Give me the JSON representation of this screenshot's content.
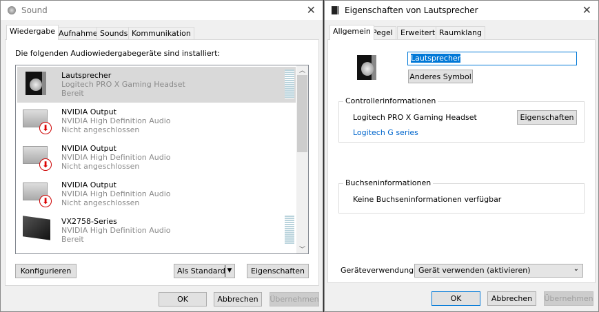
{
  "sound": {
    "title": "Sound",
    "tabs": [
      "Wiedergabe",
      "Aufnahme",
      "Sounds",
      "Kommunikation"
    ],
    "heading": "Die folgenden Audiowiedergabegeräte sind installiert:",
    "devices": [
      {
        "name": "Lautsprecher",
        "driver": "Logitech PRO X Gaming Headset",
        "status": "Bereit",
        "icon": "speaker-icon",
        "selected": true
      },
      {
        "name": "NVIDIA Output",
        "driver": "NVIDIA High Definition Audio",
        "status": "Nicht angeschlossen",
        "icon": "monitor-disconnected-icon"
      },
      {
        "name": "NVIDIA Output",
        "driver": "NVIDIA High Definition Audio",
        "status": "Nicht angeschlossen",
        "icon": "monitor-disconnected-icon"
      },
      {
        "name": "NVIDIA Output",
        "driver": "NVIDIA High Definition Audio",
        "status": "Nicht angeschlossen",
        "icon": "monitor-disconnected-icon"
      },
      {
        "name": "VX2758-Series",
        "driver": "NVIDIA High Definition Audio",
        "status": "Bereit",
        "icon": "monitor-icon"
      }
    ],
    "configure": "Konfigurieren",
    "set_default": "Als Standard",
    "properties": "Eigenschaften",
    "ok": "OK",
    "cancel": "Abbrechen",
    "apply": "Übernehmen"
  },
  "props": {
    "title": "Eigenschaften von Lautsprecher",
    "tabs": [
      "Allgemein",
      "Pegel",
      "Erweitert",
      "Raumklang"
    ],
    "name_value": "Lautsprecher",
    "change_icon": "Anderes Symbol",
    "controller_label": "Controllerinformationen",
    "controller_name": "Logitech PRO X Gaming Headset",
    "controller_props": "Eigenschaften",
    "controller_link": "Logitech G series",
    "jack_label": "Buchseninformationen",
    "jack_text": "Keine Buchseninformationen verfügbar",
    "usage_label": "Geräteverwendung:",
    "usage_value": "Gerät verwenden (aktivieren)",
    "ok": "OK",
    "cancel": "Abbrechen",
    "apply": "Übernehmen"
  },
  "colors": {
    "accent": "#0078d7",
    "link": "#0066cc"
  }
}
